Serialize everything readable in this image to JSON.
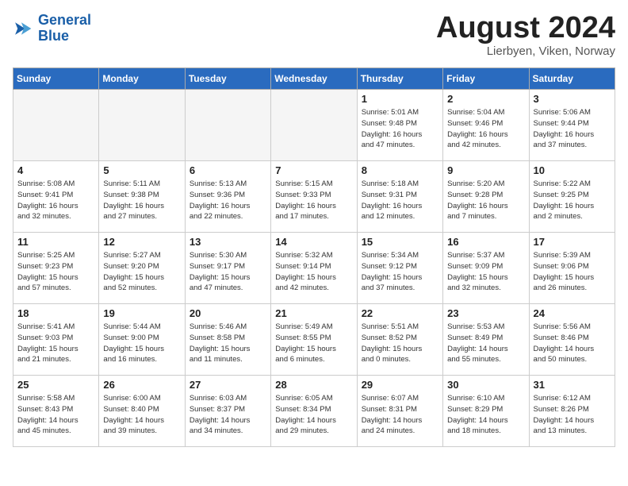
{
  "logo": {
    "line1": "General",
    "line2": "Blue"
  },
  "title": "August 2024",
  "subtitle": "Lierbyen, Viken, Norway",
  "weekdays": [
    "Sunday",
    "Monday",
    "Tuesday",
    "Wednesday",
    "Thursday",
    "Friday",
    "Saturday"
  ],
  "weeks": [
    [
      {
        "day": "",
        "info": ""
      },
      {
        "day": "",
        "info": ""
      },
      {
        "day": "",
        "info": ""
      },
      {
        "day": "",
        "info": ""
      },
      {
        "day": "1",
        "info": "Sunrise: 5:01 AM\nSunset: 9:48 PM\nDaylight: 16 hours\nand 47 minutes."
      },
      {
        "day": "2",
        "info": "Sunrise: 5:04 AM\nSunset: 9:46 PM\nDaylight: 16 hours\nand 42 minutes."
      },
      {
        "day": "3",
        "info": "Sunrise: 5:06 AM\nSunset: 9:44 PM\nDaylight: 16 hours\nand 37 minutes."
      }
    ],
    [
      {
        "day": "4",
        "info": "Sunrise: 5:08 AM\nSunset: 9:41 PM\nDaylight: 16 hours\nand 32 minutes."
      },
      {
        "day": "5",
        "info": "Sunrise: 5:11 AM\nSunset: 9:38 PM\nDaylight: 16 hours\nand 27 minutes."
      },
      {
        "day": "6",
        "info": "Sunrise: 5:13 AM\nSunset: 9:36 PM\nDaylight: 16 hours\nand 22 minutes."
      },
      {
        "day": "7",
        "info": "Sunrise: 5:15 AM\nSunset: 9:33 PM\nDaylight: 16 hours\nand 17 minutes."
      },
      {
        "day": "8",
        "info": "Sunrise: 5:18 AM\nSunset: 9:31 PM\nDaylight: 16 hours\nand 12 minutes."
      },
      {
        "day": "9",
        "info": "Sunrise: 5:20 AM\nSunset: 9:28 PM\nDaylight: 16 hours\nand 7 minutes."
      },
      {
        "day": "10",
        "info": "Sunrise: 5:22 AM\nSunset: 9:25 PM\nDaylight: 16 hours\nand 2 minutes."
      }
    ],
    [
      {
        "day": "11",
        "info": "Sunrise: 5:25 AM\nSunset: 9:23 PM\nDaylight: 15 hours\nand 57 minutes."
      },
      {
        "day": "12",
        "info": "Sunrise: 5:27 AM\nSunset: 9:20 PM\nDaylight: 15 hours\nand 52 minutes."
      },
      {
        "day": "13",
        "info": "Sunrise: 5:30 AM\nSunset: 9:17 PM\nDaylight: 15 hours\nand 47 minutes."
      },
      {
        "day": "14",
        "info": "Sunrise: 5:32 AM\nSunset: 9:14 PM\nDaylight: 15 hours\nand 42 minutes."
      },
      {
        "day": "15",
        "info": "Sunrise: 5:34 AM\nSunset: 9:12 PM\nDaylight: 15 hours\nand 37 minutes."
      },
      {
        "day": "16",
        "info": "Sunrise: 5:37 AM\nSunset: 9:09 PM\nDaylight: 15 hours\nand 32 minutes."
      },
      {
        "day": "17",
        "info": "Sunrise: 5:39 AM\nSunset: 9:06 PM\nDaylight: 15 hours\nand 26 minutes."
      }
    ],
    [
      {
        "day": "18",
        "info": "Sunrise: 5:41 AM\nSunset: 9:03 PM\nDaylight: 15 hours\nand 21 minutes."
      },
      {
        "day": "19",
        "info": "Sunrise: 5:44 AM\nSunset: 9:00 PM\nDaylight: 15 hours\nand 16 minutes."
      },
      {
        "day": "20",
        "info": "Sunrise: 5:46 AM\nSunset: 8:58 PM\nDaylight: 15 hours\nand 11 minutes."
      },
      {
        "day": "21",
        "info": "Sunrise: 5:49 AM\nSunset: 8:55 PM\nDaylight: 15 hours\nand 6 minutes."
      },
      {
        "day": "22",
        "info": "Sunrise: 5:51 AM\nSunset: 8:52 PM\nDaylight: 15 hours\nand 0 minutes."
      },
      {
        "day": "23",
        "info": "Sunrise: 5:53 AM\nSunset: 8:49 PM\nDaylight: 14 hours\nand 55 minutes."
      },
      {
        "day": "24",
        "info": "Sunrise: 5:56 AM\nSunset: 8:46 PM\nDaylight: 14 hours\nand 50 minutes."
      }
    ],
    [
      {
        "day": "25",
        "info": "Sunrise: 5:58 AM\nSunset: 8:43 PM\nDaylight: 14 hours\nand 45 minutes."
      },
      {
        "day": "26",
        "info": "Sunrise: 6:00 AM\nSunset: 8:40 PM\nDaylight: 14 hours\nand 39 minutes."
      },
      {
        "day": "27",
        "info": "Sunrise: 6:03 AM\nSunset: 8:37 PM\nDaylight: 14 hours\nand 34 minutes."
      },
      {
        "day": "28",
        "info": "Sunrise: 6:05 AM\nSunset: 8:34 PM\nDaylight: 14 hours\nand 29 minutes."
      },
      {
        "day": "29",
        "info": "Sunrise: 6:07 AM\nSunset: 8:31 PM\nDaylight: 14 hours\nand 24 minutes."
      },
      {
        "day": "30",
        "info": "Sunrise: 6:10 AM\nSunset: 8:29 PM\nDaylight: 14 hours\nand 18 minutes."
      },
      {
        "day": "31",
        "info": "Sunrise: 6:12 AM\nSunset: 8:26 PM\nDaylight: 14 hours\nand 13 minutes."
      }
    ]
  ]
}
